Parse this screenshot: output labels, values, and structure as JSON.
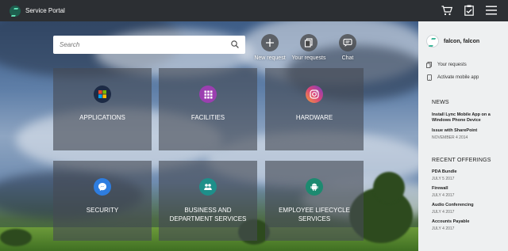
{
  "header": {
    "title": "Service Portal",
    "icons": [
      "cart-icon",
      "clipboard-check-icon",
      "hamburger-menu-icon"
    ]
  },
  "search": {
    "placeholder": "Search"
  },
  "quick_actions": [
    {
      "label": "New request",
      "icon": "plus-icon"
    },
    {
      "label": "Your requests",
      "icon": "documents-icon"
    },
    {
      "label": "Chat",
      "icon": "chat-bubble-icon"
    }
  ],
  "tiles": [
    {
      "label": "Applications",
      "icon": "windows-logo-icon",
      "color": "#1d2b45"
    },
    {
      "label": "Facilities",
      "icon": "grid-icon",
      "color": "#9b3fb0"
    },
    {
      "label": "Hardware",
      "icon": "instagram-icon",
      "color": "#d9457a"
    },
    {
      "label": "Security",
      "icon": "messenger-icon",
      "color": "#2e7de0"
    },
    {
      "label": "Business and Department Services",
      "icon": "people-icon",
      "color": "#1e8f8a"
    },
    {
      "label": "Employee Lifecycle Services",
      "icon": "android-icon",
      "color": "#1d8a70"
    }
  ],
  "panel": {
    "user_name": "falcon, falcon",
    "links": [
      {
        "label": "Your requests",
        "icon": "documents-icon"
      },
      {
        "label": "Activate mobile app",
        "icon": "mobile-phone-icon"
      }
    ],
    "news_title": "NEWS",
    "news": [
      {
        "title": "Install Lync Mobile App on a Windows Phone Device",
        "date": ""
      },
      {
        "title": "Issue with SharePoint",
        "date": "NOVEMBER 4 2014"
      }
    ],
    "offerings_title": "RECENT OFFERINGS",
    "offerings": [
      {
        "title": "PDA Bundle",
        "date": "JULY 5 2017"
      },
      {
        "title": "Firewall",
        "date": "JULY 4 2017"
      },
      {
        "title": "Audio Conferencing",
        "date": "JULY 4 2017"
      },
      {
        "title": "Accounts Payable",
        "date": "JULY 4 2017"
      }
    ]
  }
}
